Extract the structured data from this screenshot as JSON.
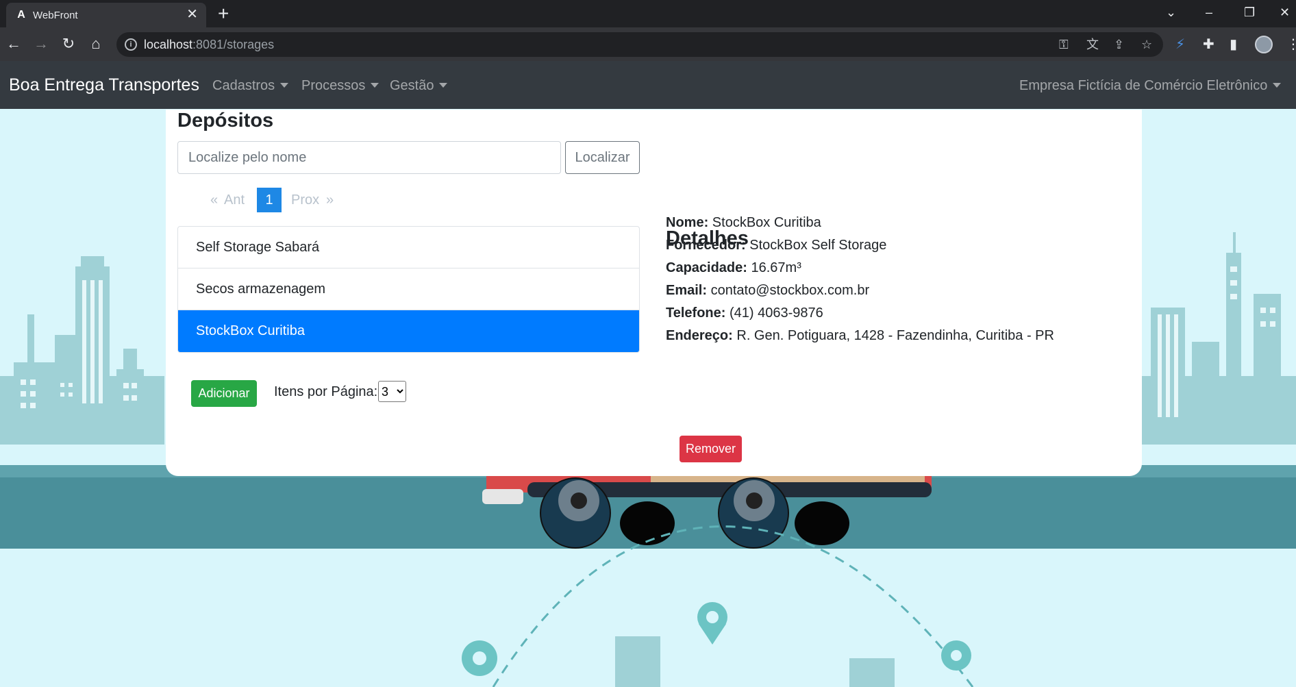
{
  "browser": {
    "tab_title": "WebFront",
    "tab_favicon": "A",
    "url_host": "localhost",
    "url_path": ":8081/storages"
  },
  "navbar": {
    "brand": "Boa Entrega Transportes",
    "menus": [
      "Cadastros",
      "Processos",
      "Gestão"
    ],
    "company": "Empresa Fictícia de Comércio Eletrônico"
  },
  "page": {
    "title": "Depósitos",
    "search_placeholder": "Localize pelo nome",
    "search_button": "Localizar"
  },
  "pagination": {
    "first": "«",
    "prev": "Ant",
    "current": "1",
    "next": "Prox",
    "last": "»"
  },
  "storages": [
    "Self Storage Sabará",
    "Secos armazenagem",
    "StockBox Curitiba"
  ],
  "selected_index": 2,
  "actions": {
    "add": "Adicionar",
    "per_page_label": "Itens por Página:",
    "per_page_value": "3",
    "remove": "Remover"
  },
  "details": {
    "title": "Detalhes",
    "fields": [
      {
        "label": "Nome:",
        "value": "StockBox Curitiba"
      },
      {
        "label": "Fornecedor:",
        "value": "StockBox Self Storage"
      },
      {
        "label": "Capacidade:",
        "value": "16.67m³"
      },
      {
        "label": "Email:",
        "value": "contato@stockbox.com.br"
      },
      {
        "label": "Telefone:",
        "value": "(41) 4063-9876"
      },
      {
        "label": "Endereço:",
        "value": "R. Gen. Potiguara, 1428 - Fazendinha, Curitiba - PR"
      }
    ]
  },
  "colors": {
    "navbar": "#343a40",
    "selected": "#007bff",
    "success": "#28a745",
    "danger": "#dc3545",
    "page_active": "#1e88e5"
  }
}
